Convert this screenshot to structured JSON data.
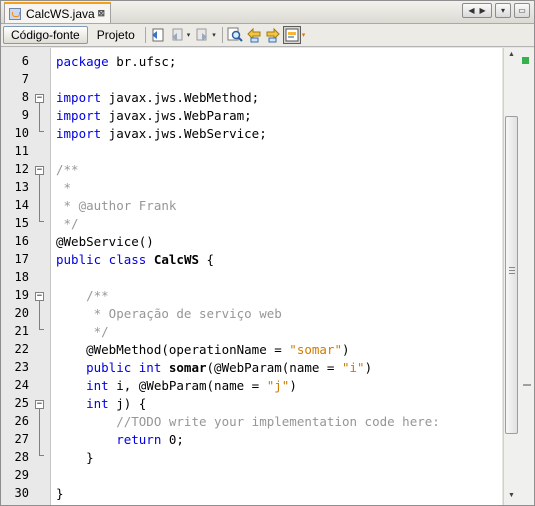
{
  "tab": {
    "title": "CalcWS.java",
    "close": "⊠"
  },
  "window_controls": {
    "left": "◀",
    "right": "▶",
    "list": "▾",
    "maximize": "▭"
  },
  "toolbar": {
    "source_label": "Código-fonte",
    "design_label": "Projeto",
    "drop_arrow": "▾"
  },
  "scrollbar": {
    "up": "▲",
    "down": "▼"
  },
  "editor": {
    "lines": [
      {
        "no": "6"
      },
      {
        "no": "7"
      },
      {
        "no": "8"
      },
      {
        "no": "9"
      },
      {
        "no": "10"
      },
      {
        "no": "11"
      },
      {
        "no": "12"
      },
      {
        "no": "13"
      },
      {
        "no": "14"
      },
      {
        "no": "15"
      },
      {
        "no": "16"
      },
      {
        "no": "17"
      },
      {
        "no": "18"
      },
      {
        "no": "19"
      },
      {
        "no": "20"
      },
      {
        "no": "21"
      },
      {
        "no": "22"
      },
      {
        "no": "23"
      },
      {
        "no": "24"
      },
      {
        "no": "25"
      },
      {
        "no": "26"
      },
      {
        "no": "27"
      },
      {
        "no": "28"
      },
      {
        "no": "29"
      },
      {
        "no": "30"
      }
    ],
    "code": {
      "l6_kw": "package",
      "l6_rest": " br.ufsc;",
      "l8_kw": "import",
      "l8_rest": " javax.jws.WebMethod;",
      "l9_kw": "import",
      "l9_rest": " javax.jws.WebParam;",
      "l10_kw": "import",
      "l10_rest": " javax.jws.WebService;",
      "l12": "/**",
      "l13": " *",
      "l14": " * @author Frank",
      "l15": " */",
      "l16": "@WebService()",
      "l17_kw": "public class",
      "l17_name": " CalcWS",
      "l17_rest": " {",
      "l19": "    /**",
      "l20": "     * Operação de serviço web",
      "l21": "     */",
      "l22_a": "    @WebMethod(operationName = ",
      "l22_s": "\"somar\"",
      "l22_b": ")",
      "l23_kw": "    public int",
      "l23_name": " somar",
      "l23_a": "(@WebParam(name = ",
      "l23_s": "\"i\"",
      "l23_b": ")",
      "l24_kw": "    int",
      "l24_a": " i, @WebParam(name = ",
      "l24_s": "\"j\"",
      "l24_b": ")",
      "l25_kw": "    int",
      "l25_a": " j) {",
      "l26": "        //TODO write your implementation code here:",
      "l27_kw": "        return",
      "l27_a": " 0;",
      "l28": "    }",
      "l30": "}"
    }
  }
}
